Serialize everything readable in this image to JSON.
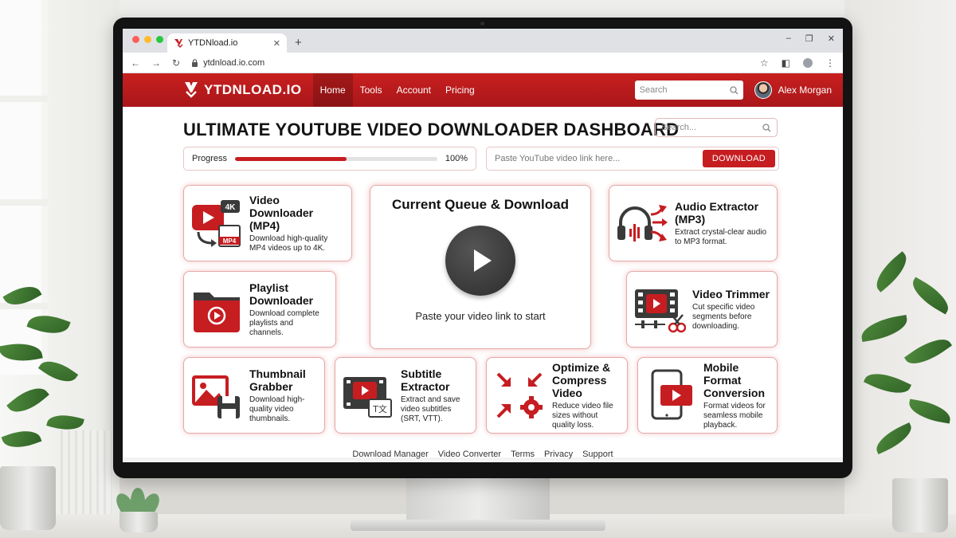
{
  "browser": {
    "tab_title": "YTDNload.io",
    "new_tab": "+",
    "url": "ytdnload.io.com",
    "controls": {
      "minimize": "–",
      "maximize": "❐",
      "close": "✕"
    }
  },
  "nav": {
    "logo_text": "YTDNLOAD.IO",
    "links": [
      {
        "label": "Home",
        "active": true
      },
      {
        "label": "Tools"
      },
      {
        "label": "Account"
      },
      {
        "label": "Pricing"
      }
    ],
    "search_placeholder": "Search",
    "user_name": "Alex Morgan"
  },
  "dashboard": {
    "title": "ULTIMATE YOUTUBE VIDEO DOWNLOADER DASHBOARD",
    "search_placeholder": "Search...",
    "progress": {
      "label": "Progress",
      "value": 0.55,
      "text": "100%"
    },
    "paste_placeholder": "Paste YouTube video link here...",
    "download_button": "DOWNLOAD",
    "queue": {
      "title": "Current Queue & Download",
      "hint": "Paste your video link to start"
    },
    "cards": [
      {
        "id": "video-downloader",
        "title": "Video Downloader (MP4)",
        "desc": "Download high-quality MP4 videos up to 4K.",
        "badge_top": "4K",
        "badge_bottom": "MP4"
      },
      {
        "id": "audio-extractor",
        "title": "Audio Extractor (MP3)",
        "desc": "Extract crystal-clear audio to MP3 format."
      },
      {
        "id": "playlist-downloader",
        "title": "Playlist Downloader",
        "desc": "Download complete playlists and channels."
      },
      {
        "id": "video-trimmer",
        "title": "Video Trimmer",
        "desc": "Cut specific video segments before downloading."
      },
      {
        "id": "thumbnail-grabber",
        "title": "Thumbnail Grabber",
        "desc": "Download high-quality video thumbnails."
      },
      {
        "id": "subtitle-extractor",
        "title": "Subtitle Extractor",
        "desc": "Extract and save video subtitles (SRT, VTT)."
      },
      {
        "id": "optimize-compress",
        "title": "Optimize & Compress Video",
        "desc": "Reduce video file sizes without quality loss."
      },
      {
        "id": "mobile-format",
        "title": "Mobile Format Conversion",
        "desc": "Format videos for seamless mobile playback."
      }
    ]
  },
  "footer": {
    "links": [
      "Download Manager",
      "Video Converter",
      "Terms",
      "Privacy",
      "Support"
    ]
  },
  "colors": {
    "brand_red": "#c61d21",
    "dark_icon": "#3a3a3a"
  }
}
